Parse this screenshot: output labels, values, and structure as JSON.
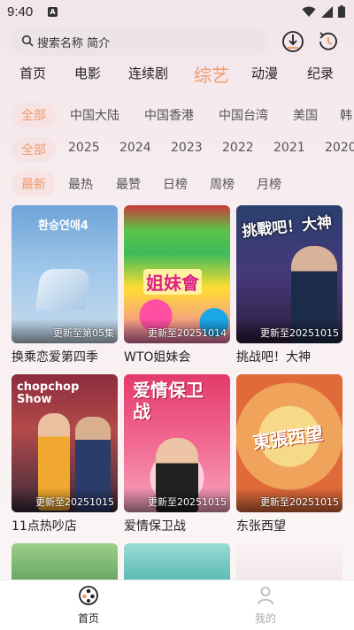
{
  "status": {
    "time": "9:40",
    "app_badge": "A"
  },
  "search": {
    "placeholder": "搜索名称 简介"
  },
  "tabs": [
    "首页",
    "电影",
    "连续剧",
    "综艺",
    "动漫",
    "纪录"
  ],
  "filters": {
    "region": [
      "全部",
      "中国大陆",
      "中国香港",
      "中国台湾",
      "美国",
      "韩"
    ],
    "year": [
      "全部",
      "2025",
      "2024",
      "2023",
      "2022",
      "2021",
      "2020"
    ],
    "sort": [
      "最新",
      "最热",
      "最赞",
      "日榜",
      "周榜",
      "月榜"
    ]
  },
  "cards": [
    {
      "title": "换乘恋爱第四季",
      "badge": "更新至第05集",
      "poster_text": "환승연애4"
    },
    {
      "title": "WTO姐妹会",
      "badge": "更新至20251014",
      "poster_text": "姐妹會"
    },
    {
      "title": "挑战吧！大神",
      "badge": "更新至20251015",
      "poster_text": "挑戰吧！大神"
    },
    {
      "title": "11点热吵店",
      "badge": "更新至20251015",
      "poster_text": "chopchop Show"
    },
    {
      "title": "爱情保卫战",
      "badge": "更新至20251015",
      "poster_text": "爱情保卫战"
    },
    {
      "title": "东张西望",
      "badge": "更新至20251015",
      "poster_text": "東張西望"
    }
  ],
  "bottom_nav": [
    {
      "label": "首页",
      "icon": "home-film-icon",
      "active": true
    },
    {
      "label": "我的",
      "icon": "user-icon",
      "active": false
    }
  ],
  "colors": {
    "accent": "#f09a6a",
    "selected_bg": "#f6e3e3"
  }
}
